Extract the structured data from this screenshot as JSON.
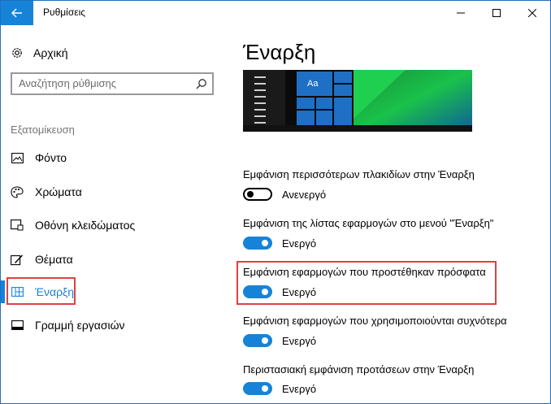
{
  "window": {
    "title": "Ρυθμίσεις"
  },
  "sidebar": {
    "home_label": "Αρχική",
    "search": {
      "placeholder": "Αναζήτηση ρύθμισης"
    },
    "section_label": "Εξατομίκευση",
    "items": [
      {
        "label": "Φόντο",
        "icon": "picture-icon"
      },
      {
        "label": "Χρώματα",
        "icon": "palette-icon"
      },
      {
        "label": "Οθόνη κλειδώματος",
        "icon": "lock-screen-icon"
      },
      {
        "label": "Θέματα",
        "icon": "themes-icon"
      },
      {
        "label": "Έναρξη",
        "icon": "start-icon",
        "active": true
      },
      {
        "label": "Γραμμή εργασιών",
        "icon": "taskbar-icon"
      }
    ]
  },
  "main": {
    "title": "Έναρξη",
    "preview": {
      "tile_text": "Aa"
    },
    "settings": [
      {
        "label": "Εμφάνιση περισσότερων πλακιδίων στην Έναρξη",
        "on": false,
        "state": "Ανενεργό"
      },
      {
        "label": "Εμφάνιση της λίστας εφαρμογών στο μενού \"Έναρξη\"",
        "on": true,
        "state": "Ενεργό"
      },
      {
        "label": "Εμφάνιση εφαρμογών που προστέθηκαν πρόσφατα",
        "on": true,
        "state": "Ενεργό"
      },
      {
        "label": "Εμφάνιση εφαρμογών που χρησιμοποιούνται συχνότερα",
        "on": true,
        "state": "Ενεργό"
      },
      {
        "label": "Περιστασιακή εμφάνιση προτάσεων στην Έναρξη",
        "on": true,
        "state": "Ενεργό"
      }
    ]
  },
  "colors": {
    "accent": "#1683d8",
    "highlight": "#e04040"
  }
}
